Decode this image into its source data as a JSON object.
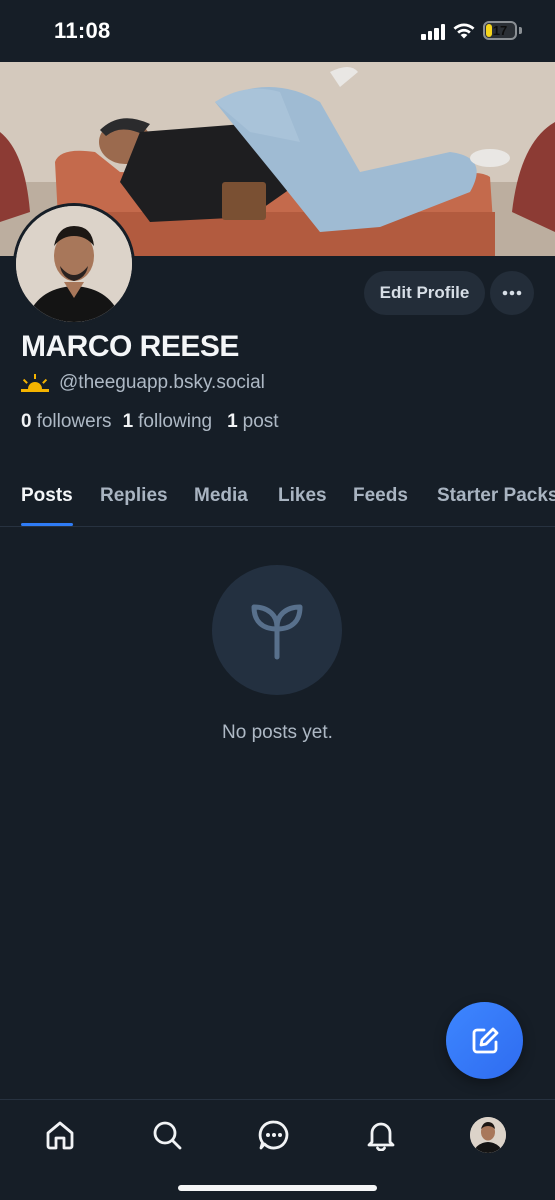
{
  "status_bar": {
    "time": "11:08",
    "battery_level": "17",
    "battery_color": "#f5d51b"
  },
  "profile": {
    "display_name": "MARCO REESE",
    "handle": "@theeguapp.bsky.social",
    "handle_emoji": "sunrise-icon",
    "edit_label": "Edit Profile",
    "stats": [
      {
        "count": "0",
        "label": "followers"
      },
      {
        "count": "1",
        "label": "following"
      },
      {
        "count": "1",
        "label": "post"
      }
    ]
  },
  "tabs": [
    {
      "label": "Posts",
      "active": true
    },
    {
      "label": "Replies",
      "active": false
    },
    {
      "label": "Media",
      "active": false
    },
    {
      "label": "Likes",
      "active": false
    },
    {
      "label": "Feeds",
      "active": false
    },
    {
      "label": "Starter Packs",
      "active": false
    }
  ],
  "empty_state": {
    "icon": "seedling-icon",
    "text": "No posts yet."
  },
  "fab": {
    "icon": "compose-icon",
    "color": "#3d86ff"
  },
  "bottom_nav": [
    {
      "icon": "home-icon"
    },
    {
      "icon": "search-icon"
    },
    {
      "icon": "chat-icon"
    },
    {
      "icon": "bell-icon"
    },
    {
      "icon": "profile-avatar"
    }
  ],
  "colors": {
    "background": "#161e27",
    "accent": "#2f7cf6",
    "muted_text": "#aeb9c5"
  }
}
